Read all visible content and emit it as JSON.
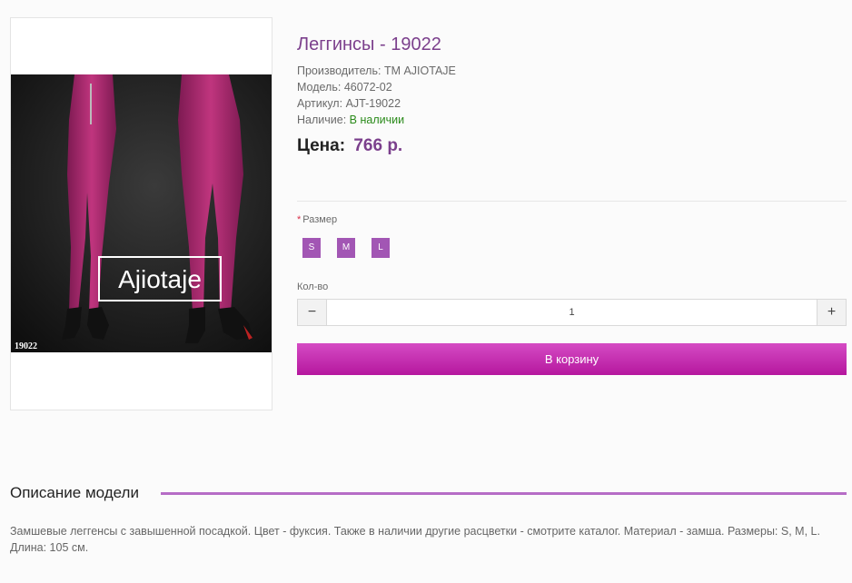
{
  "product": {
    "title": "Леггинсы - 19022",
    "manufacturer_label": "Производитель:",
    "manufacturer": "ТМ AJIOTAJE",
    "model_label": "Модель:",
    "model": "46072-02",
    "sku_label": "Артикул:",
    "sku": "AJT-19022",
    "availability_label": "Наличие:",
    "availability": "В наличии",
    "price_label": "Цена:",
    "price": "766 р.",
    "image": {
      "brand_text": "Ajiotaje",
      "code_text": "19022"
    }
  },
  "options": {
    "required_mark": "*",
    "size_label": "Размер",
    "sizes": [
      "S",
      "M",
      "L"
    ]
  },
  "quantity": {
    "label": "Кол-во",
    "value": "1",
    "minus": "−",
    "plus": "+"
  },
  "cart_button": "В корзину",
  "description": {
    "title": "Описание модели",
    "text": "Замшевые леггенсы с завышенной посадкой. Цвет - фуксия. Также в наличии другие расцветки - смотрите каталог. Материал - замша. Размеры: S, M, L. Длина: 105 см."
  },
  "colors": {
    "accent": "#7b3f8c",
    "button": "#c02aaf",
    "size_swatch": "#a256b4",
    "in_stock": "#2a8a1a"
  }
}
